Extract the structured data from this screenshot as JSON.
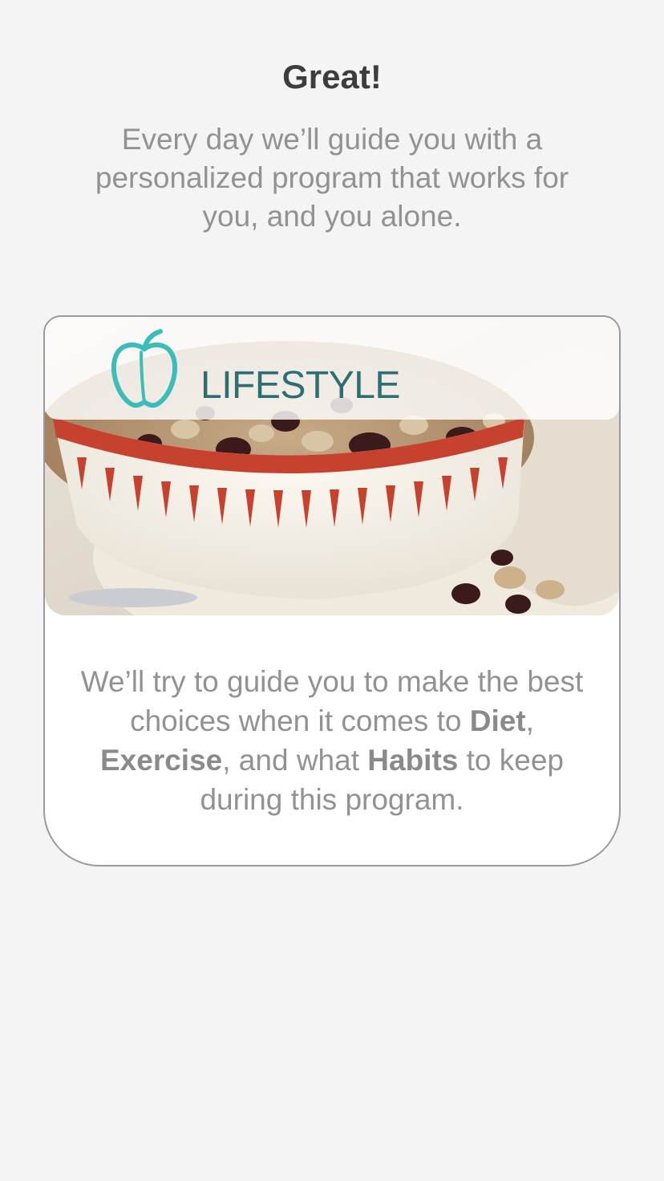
{
  "header": {
    "title": "Great!",
    "subtitle": "Every day we’ll guide you with a personalized program that works for you, and you alone."
  },
  "card": {
    "image_description_icon": "oatmeal-bowl-photo",
    "banner_icon": "apple-icon",
    "banner_label": "LIFESTYLE",
    "body": {
      "part1": "We’ll try to guide you to make the best choices when it comes to ",
      "diet": "Diet",
      "part2": ", ",
      "exercise": "Exercise",
      "part3": ", and what ",
      "habits": "Habits",
      "part4": " to keep during this program."
    }
  },
  "colors": {
    "background": "#f4f4f4",
    "title": "#3d3d3d",
    "body_text": "#929292",
    "accent_teal": "#3bbdb9",
    "banner_text": "#2c6f73",
    "card_border": "#9a9a9a"
  }
}
